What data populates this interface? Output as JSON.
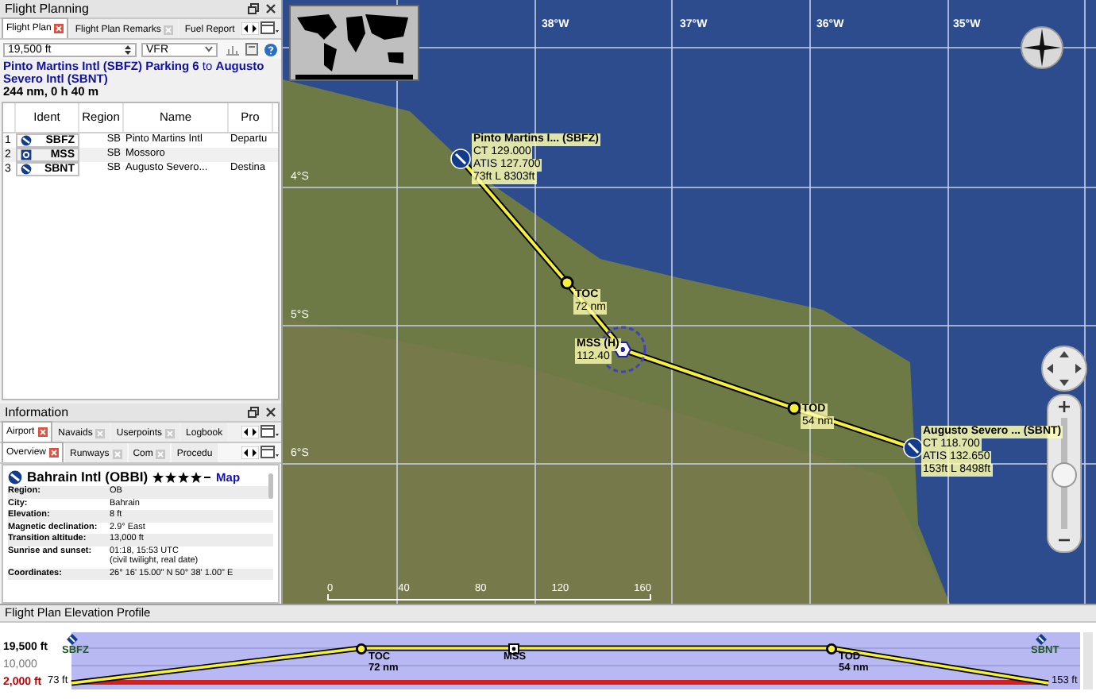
{
  "flight_planning": {
    "title": "Flight Planning",
    "tabs": [
      {
        "label": "Flight Plan",
        "selected": true
      },
      {
        "label": "Flight Plan Remarks",
        "selected": false
      },
      {
        "label": "Fuel Report",
        "selected": false
      }
    ],
    "altitude": "19,500 ft",
    "flight_rules": "VFR",
    "route_summary": "**Pinto Martins Intl (SBFZ) Parking 6** to **Augusto Severo Intl (SBNT)**",
    "distance_time": "244 nm, 0 h 40 m",
    "table": {
      "columns": [
        "Ident",
        "Region",
        "Name",
        "Pro"
      ],
      "rows": [
        {
          "number": "1",
          "kind": "airport",
          "ident": "SBFZ",
          "region": "SB",
          "name": "Pinto Martins Intl",
          "column_4": "Departu"
        },
        {
          "number": "2",
          "kind": "navaid",
          "ident": "MSS",
          "region": "SB",
          "name": "Mossoro",
          "column_4": ""
        },
        {
          "number": "3",
          "kind": "airport",
          "ident": "SBNT",
          "region": "SB",
          "name": "Augusto Severo...",
          "column_4": "Destina"
        }
      ]
    }
  },
  "information": {
    "title": "Information",
    "tabs": [
      {
        "label": "Airport",
        "selected": true
      },
      {
        "label": "Navaids",
        "selected": false
      },
      {
        "label": "Userpoints",
        "selected": false
      },
      {
        "label": "Logbook",
        "selected": false
      }
    ],
    "subtabs": [
      {
        "label": "Overview",
        "selected": true
      },
      {
        "label": "Runways",
        "selected": false
      },
      {
        "label": "Com",
        "selected": false
      },
      {
        "label": "Procedu",
        "selected": false
      }
    ],
    "airport": {
      "name": "Bahrain Intl (OBBI)",
      "stars": 4,
      "map_link": "Map"
    },
    "fields": [
      {
        "label": "Region:",
        "value": "OB"
      },
      {
        "label": "City:",
        "value": "Bahrain"
      },
      {
        "label": "Elevation:",
        "value": "8 ft"
      },
      {
        "label": "Magnetic declination:",
        "value": "2.9° East"
      },
      {
        "label": "Transition altitude:",
        "value": "13,000 ft"
      },
      {
        "label": "Sunrise and sunset:",
        "value": "01:18, 15:53 UTC",
        "note": "(civil twilight, real date)"
      },
      {
        "label": "Coordinates:",
        "value": "26° 16' 15.00\" N 50° 38' 1.00\" E"
      }
    ]
  },
  "map": {
    "longitude_labels": [
      "38°W",
      "37°W",
      "36°W",
      "35°W"
    ],
    "latitude_labels": [
      "4°S",
      "5°S",
      "6°S"
    ],
    "scale_labels": [
      "0",
      "40",
      "80",
      "120",
      "160"
    ],
    "waypoints": [
      {
        "kind": "airport",
        "lines": [
          "Pinto Martins I... (SBFZ)",
          "CT 129.000",
          "ATIS 127.700",
          "73ft L 8303ft"
        ]
      },
      {
        "kind": "toc",
        "lines": [
          "TOC",
          "72 nm"
        ]
      },
      {
        "kind": "vor",
        "lines": [
          "MSS (H)",
          "112.40"
        ]
      },
      {
        "kind": "tod",
        "lines": [
          "TOD",
          "54 nm"
        ]
      },
      {
        "kind": "airport",
        "lines": [
          "Augusto Severo ... (SBNT)",
          "CT 118.700",
          "ATIS 132.650",
          "153ft L 8498ft"
        ]
      }
    ],
    "zoom_slider": {
      "level": 0.48
    }
  },
  "elevation_profile": {
    "title": "Flight Plan Elevation Profile",
    "altitude_labels": [
      {
        "kind": "cruise",
        "text": "19,500 ft"
      },
      {
        "kind": "grid",
        "text": "10,000"
      },
      {
        "kind": "safe",
        "text": "2,000 ft"
      }
    ],
    "departure_elevation": "73 ft",
    "arrival_elevation": "153 ft",
    "waypoints": [
      {
        "kind": "airport",
        "ident": "SBFZ"
      },
      {
        "kind": "toc",
        "ident": "TOC",
        "distance": "72 nm"
      },
      {
        "kind": "vor",
        "ident": "MSS"
      },
      {
        "kind": "tod",
        "ident": "TOD",
        "distance": "54 nm"
      },
      {
        "kind": "airport",
        "ident": "SBNT"
      }
    ]
  }
}
